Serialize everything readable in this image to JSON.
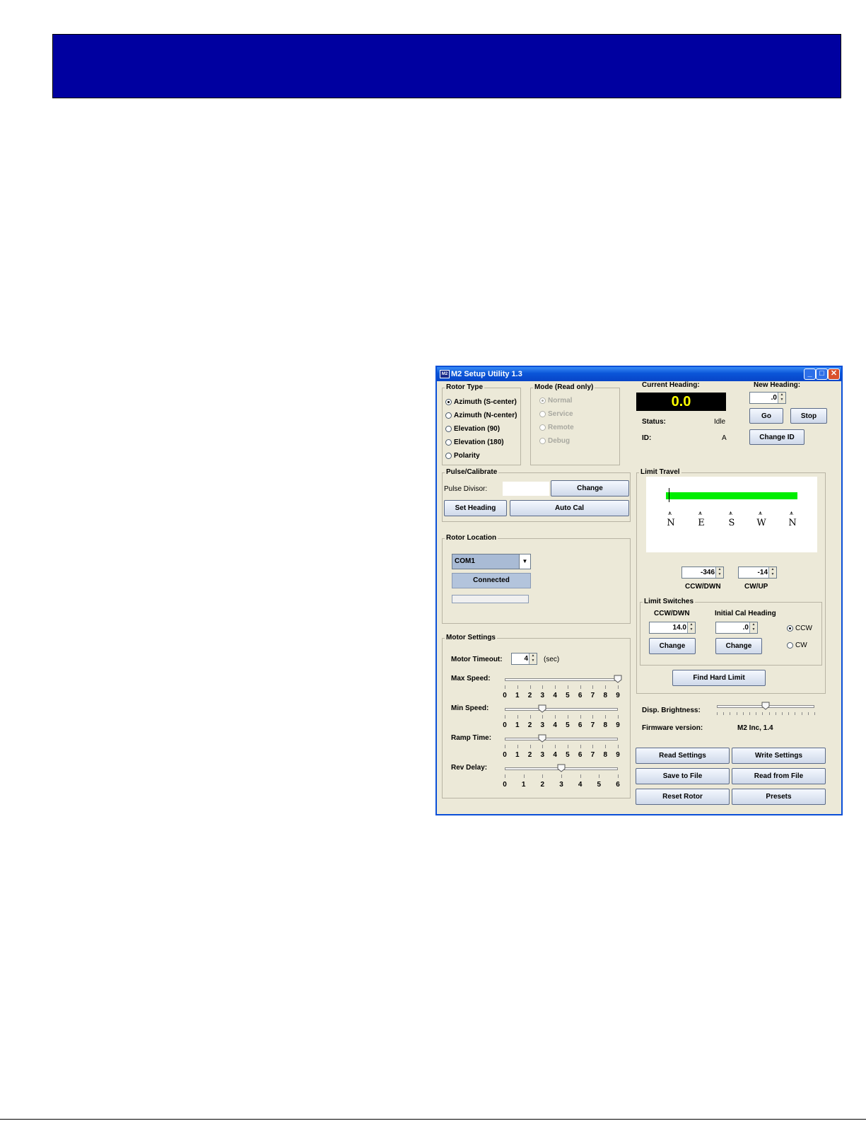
{
  "window": {
    "title": "M2 Setup Utility 1.3",
    "icon": "M2",
    "controls": {
      "minimize": "_",
      "maximize": "□",
      "close": "✕"
    }
  },
  "rotor_type": {
    "legend": "Rotor Type",
    "options": [
      {
        "label": "Azimuth (S-center)",
        "selected": true
      },
      {
        "label": "Azimuth (N-center)",
        "selected": false
      },
      {
        "label": "Elevation (90)",
        "selected": false
      },
      {
        "label": "Elevation (180)",
        "selected": false
      },
      {
        "label": "Polarity",
        "selected": false
      }
    ]
  },
  "mode": {
    "legend": "Mode (Read only)",
    "options": [
      {
        "label": "Normal",
        "selected": true
      },
      {
        "label": "Service",
        "selected": false
      },
      {
        "label": "Remote",
        "selected": false
      },
      {
        "label": "Debug",
        "selected": false
      }
    ]
  },
  "heading": {
    "current_label": "Current Heading:",
    "current_value": "0.0",
    "new_label": "New Heading:",
    "new_value": ".0",
    "go": "Go",
    "stop": "Stop",
    "status_label": "Status:",
    "status_value": "Idle",
    "id_label": "ID:",
    "id_value": "A",
    "change_id": "Change ID"
  },
  "pulse": {
    "legend": "Pulse/Calibrate",
    "divisor_label": "Pulse Divisor:",
    "divisor_value": "",
    "change": "Change",
    "set_heading": "Set Heading",
    "auto_cal": "Auto Cal"
  },
  "rotor_location": {
    "legend": "Rotor Location",
    "port": "COM1",
    "connected": "Connected"
  },
  "motor": {
    "legend": "Motor Settings",
    "timeout_label": "Motor Timeout:",
    "timeout_value": "4",
    "timeout_unit": "(sec)",
    "max_speed_label": "Max Speed:",
    "max_speed": 9,
    "min_speed_label": "Min Speed:",
    "min_speed": 3,
    "ramp_label": "Ramp Time:",
    "ramp_time": 3,
    "rev_label": "Rev Delay:",
    "rev_delay": 3,
    "scale_0_9": [
      "0",
      "1",
      "2",
      "3",
      "4",
      "5",
      "6",
      "7",
      "8",
      "9"
    ],
    "scale_0_6": [
      "0",
      "1",
      "2",
      "3",
      "4",
      "5",
      "6"
    ]
  },
  "limit_travel": {
    "legend": "Limit Travel",
    "compass": [
      "N",
      "E",
      "S",
      "W",
      "N"
    ],
    "ccw_value": "-346",
    "cw_value": "-14",
    "ccw_label": "CCW/DWN",
    "cw_label": "CW/UP",
    "bar_color": "#00ee00"
  },
  "limit_switches": {
    "legend": "Limit Switches",
    "ccw_label": "CCW/DWN",
    "initial_label": "Initial Cal Heading",
    "ccw_value": "14.0",
    "initial_value": ".0",
    "change1": "Change",
    "change2": "Change",
    "dir_ccw": "CCW",
    "dir_cw": "CW",
    "selected": "CCW",
    "find_hard_limit": "Find Hard Limit"
  },
  "display": {
    "brightness_label": "Disp. Brightness:",
    "brightness_level": 0.5,
    "firmware_label": "Firmware version:",
    "firmware_value": "M2 Inc, 1.4"
  },
  "actions": {
    "read_settings": "Read Settings",
    "write_settings": "Write Settings",
    "save_file": "Save to File",
    "read_file": "Read from File",
    "reset_rotor": "Reset Rotor",
    "presets": "Presets"
  }
}
